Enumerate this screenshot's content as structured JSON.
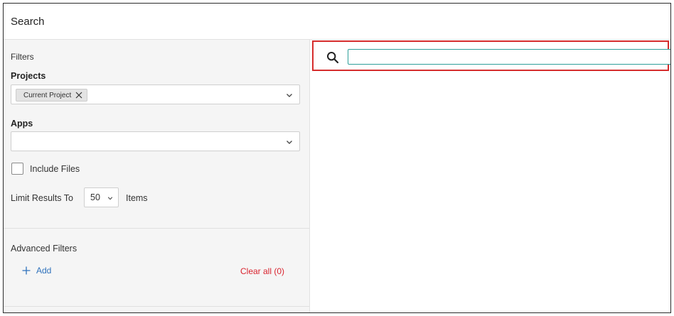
{
  "header": {
    "title": "Search"
  },
  "sidebar": {
    "filters_label": "Filters",
    "projects": {
      "label": "Projects",
      "chips": [
        "Current Project"
      ]
    },
    "apps": {
      "label": "Apps",
      "value": ""
    },
    "include_files": {
      "label": "Include Files",
      "checked": false
    },
    "limit": {
      "label": "Limit Results To",
      "value": "50",
      "suffix": "Items"
    },
    "advanced": {
      "label": "Advanced Filters",
      "add_label": "Add",
      "clear_label": "Clear all (0)"
    }
  },
  "search": {
    "value": "",
    "placeholder": ""
  },
  "colors": {
    "accent_blue": "#2f72bc",
    "danger_red": "#d9232e",
    "highlight_red": "#d62d2d",
    "input_focus": "#2f9f9a"
  }
}
